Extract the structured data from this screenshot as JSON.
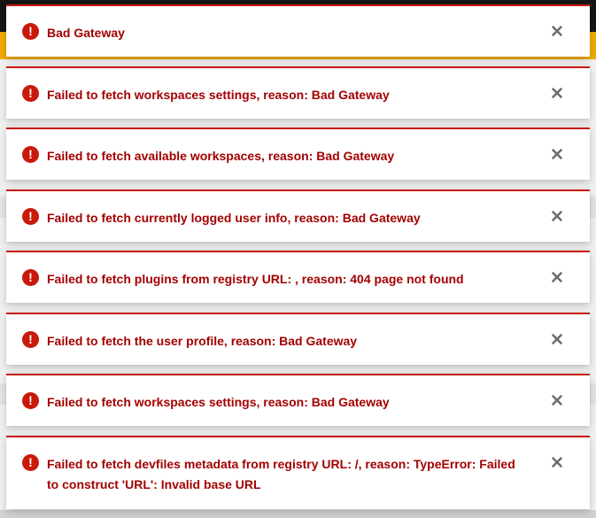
{
  "colors": {
    "danger_accent": "#c9190b",
    "danger_title": "#a30000",
    "close_icon": "#6a6e73",
    "background_topbar": "#151515",
    "background_banner": "#f0ab00"
  },
  "alert_icon": {
    "name": "exclamation-circle-icon",
    "glyph": "!"
  },
  "close_icon_name": "times-icon",
  "alerts": [
    {
      "title": "Bad Gateway"
    },
    {
      "title": "Failed to fetch workspaces settings, reason: Bad Gateway"
    },
    {
      "title": "Failed to fetch available workspaces, reason: Bad Gateway"
    },
    {
      "title": "Failed to fetch currently logged user info, reason: Bad Gateway"
    },
    {
      "title": "Failed to fetch plugins from registry URL: , reason: 404 page not found"
    },
    {
      "title": "Failed to fetch the user profile, reason: Bad Gateway"
    },
    {
      "title": "Failed to fetch workspaces settings, reason: Bad Gateway"
    },
    {
      "title": "Failed to fetch devfiles metadata from registry URL: /, reason: TypeError: Failed to construct 'URL': Invalid base URL"
    }
  ]
}
